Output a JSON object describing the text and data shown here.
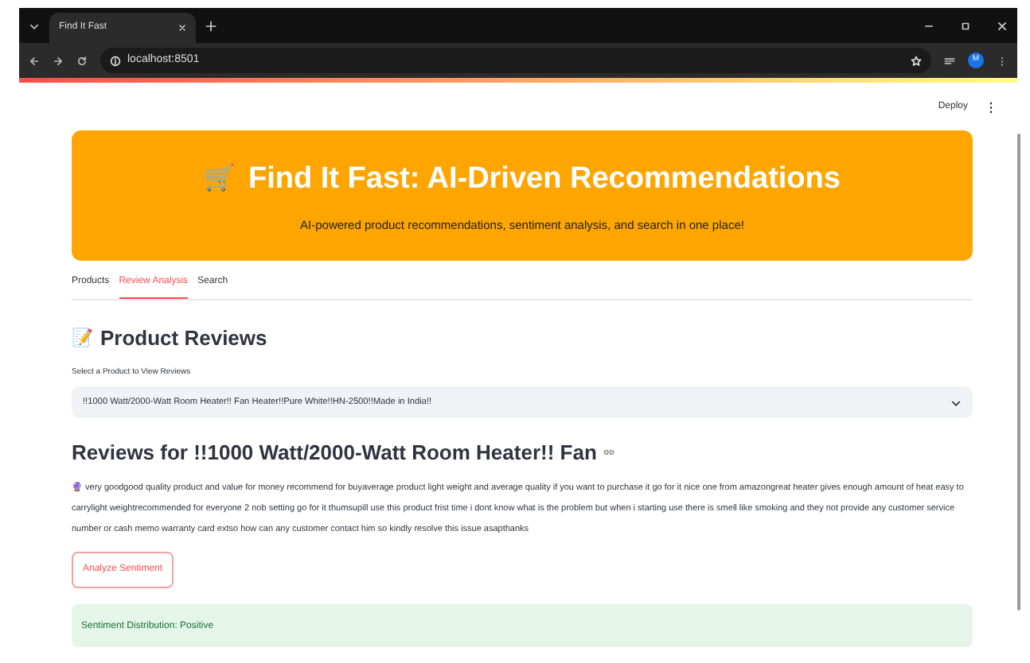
{
  "browser": {
    "tab_title": "Find It Fast",
    "address": "localhost:8501",
    "avatar": "M"
  },
  "app_bar": {
    "deploy": "Deploy"
  },
  "banner": {
    "icon": "🛒",
    "title": "Find It Fast: AI-Driven Recommendations",
    "subtitle": "AI-powered product recommendations, sentiment analysis, and search in one place!"
  },
  "tabs": [
    {
      "label": "Products",
      "selected": false
    },
    {
      "label": "Review Analysis",
      "selected": true
    },
    {
      "label": "Search",
      "selected": false
    }
  ],
  "section": {
    "icon": "📝",
    "title": "Product Reviews"
  },
  "select": {
    "label": "Select a Product to View Reviews",
    "value": "!!1000 Watt/2000-Watt Room Heater!! Fan Heater!!Pure White!!HN-2500!!Made in India!!"
  },
  "reviews_heading": "Reviews for !!1000 Watt/2000-Watt Room Heater!! Fan",
  "review": {
    "icon": "🔮",
    "text": "very goodgood quality product and value for money recommend for buyaverage product light weight and average quality if you want to purchase it go for it nice one from amazongreat heater gives enough amount of heat easy to carrylight weightrecommended for everyone 2 nob setting go for it thumsupill use this product frist time i dont know what is the problem but when i starting use there is smell like smoking and they not provide any customer service number or cash memo warranty card extso how can any customer contact him so kindly resolve this issue asapthanks"
  },
  "analyze_button": "Analyze Sentiment",
  "result": "Sentiment Distribution: Positive"
}
